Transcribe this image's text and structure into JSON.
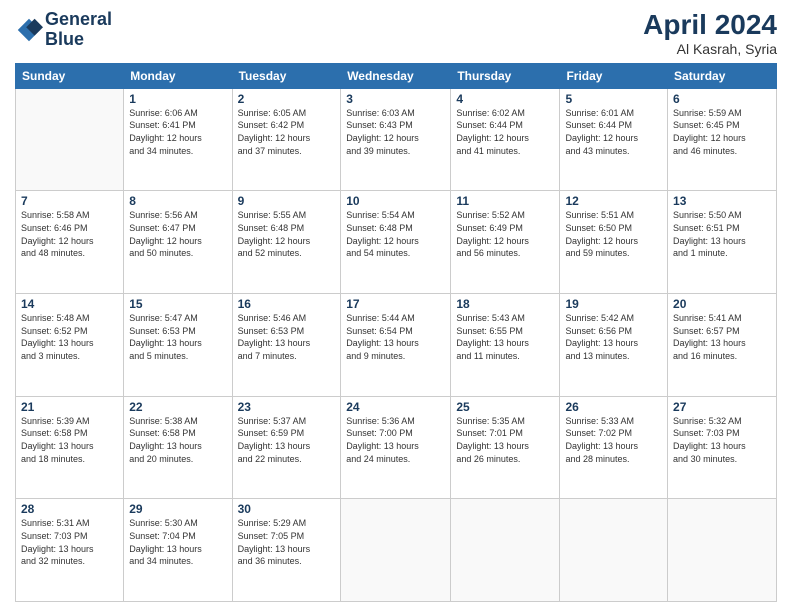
{
  "header": {
    "logo_line1": "General",
    "logo_line2": "Blue",
    "title": "April 2024",
    "location": "Al Kasrah, Syria"
  },
  "weekdays": [
    "Sunday",
    "Monday",
    "Tuesday",
    "Wednesday",
    "Thursday",
    "Friday",
    "Saturday"
  ],
  "weeks": [
    [
      {
        "day": "",
        "info": ""
      },
      {
        "day": "1",
        "info": "Sunrise: 6:06 AM\nSunset: 6:41 PM\nDaylight: 12 hours\nand 34 minutes."
      },
      {
        "day": "2",
        "info": "Sunrise: 6:05 AM\nSunset: 6:42 PM\nDaylight: 12 hours\nand 37 minutes."
      },
      {
        "day": "3",
        "info": "Sunrise: 6:03 AM\nSunset: 6:43 PM\nDaylight: 12 hours\nand 39 minutes."
      },
      {
        "day": "4",
        "info": "Sunrise: 6:02 AM\nSunset: 6:44 PM\nDaylight: 12 hours\nand 41 minutes."
      },
      {
        "day": "5",
        "info": "Sunrise: 6:01 AM\nSunset: 6:44 PM\nDaylight: 12 hours\nand 43 minutes."
      },
      {
        "day": "6",
        "info": "Sunrise: 5:59 AM\nSunset: 6:45 PM\nDaylight: 12 hours\nand 46 minutes."
      }
    ],
    [
      {
        "day": "7",
        "info": "Sunrise: 5:58 AM\nSunset: 6:46 PM\nDaylight: 12 hours\nand 48 minutes."
      },
      {
        "day": "8",
        "info": "Sunrise: 5:56 AM\nSunset: 6:47 PM\nDaylight: 12 hours\nand 50 minutes."
      },
      {
        "day": "9",
        "info": "Sunrise: 5:55 AM\nSunset: 6:48 PM\nDaylight: 12 hours\nand 52 minutes."
      },
      {
        "day": "10",
        "info": "Sunrise: 5:54 AM\nSunset: 6:48 PM\nDaylight: 12 hours\nand 54 minutes."
      },
      {
        "day": "11",
        "info": "Sunrise: 5:52 AM\nSunset: 6:49 PM\nDaylight: 12 hours\nand 56 minutes."
      },
      {
        "day": "12",
        "info": "Sunrise: 5:51 AM\nSunset: 6:50 PM\nDaylight: 12 hours\nand 59 minutes."
      },
      {
        "day": "13",
        "info": "Sunrise: 5:50 AM\nSunset: 6:51 PM\nDaylight: 13 hours\nand 1 minute."
      }
    ],
    [
      {
        "day": "14",
        "info": "Sunrise: 5:48 AM\nSunset: 6:52 PM\nDaylight: 13 hours\nand 3 minutes."
      },
      {
        "day": "15",
        "info": "Sunrise: 5:47 AM\nSunset: 6:53 PM\nDaylight: 13 hours\nand 5 minutes."
      },
      {
        "day": "16",
        "info": "Sunrise: 5:46 AM\nSunset: 6:53 PM\nDaylight: 13 hours\nand 7 minutes."
      },
      {
        "day": "17",
        "info": "Sunrise: 5:44 AM\nSunset: 6:54 PM\nDaylight: 13 hours\nand 9 minutes."
      },
      {
        "day": "18",
        "info": "Sunrise: 5:43 AM\nSunset: 6:55 PM\nDaylight: 13 hours\nand 11 minutes."
      },
      {
        "day": "19",
        "info": "Sunrise: 5:42 AM\nSunset: 6:56 PM\nDaylight: 13 hours\nand 13 minutes."
      },
      {
        "day": "20",
        "info": "Sunrise: 5:41 AM\nSunset: 6:57 PM\nDaylight: 13 hours\nand 16 minutes."
      }
    ],
    [
      {
        "day": "21",
        "info": "Sunrise: 5:39 AM\nSunset: 6:58 PM\nDaylight: 13 hours\nand 18 minutes."
      },
      {
        "day": "22",
        "info": "Sunrise: 5:38 AM\nSunset: 6:58 PM\nDaylight: 13 hours\nand 20 minutes."
      },
      {
        "day": "23",
        "info": "Sunrise: 5:37 AM\nSunset: 6:59 PM\nDaylight: 13 hours\nand 22 minutes."
      },
      {
        "day": "24",
        "info": "Sunrise: 5:36 AM\nSunset: 7:00 PM\nDaylight: 13 hours\nand 24 minutes."
      },
      {
        "day": "25",
        "info": "Sunrise: 5:35 AM\nSunset: 7:01 PM\nDaylight: 13 hours\nand 26 minutes."
      },
      {
        "day": "26",
        "info": "Sunrise: 5:33 AM\nSunset: 7:02 PM\nDaylight: 13 hours\nand 28 minutes."
      },
      {
        "day": "27",
        "info": "Sunrise: 5:32 AM\nSunset: 7:03 PM\nDaylight: 13 hours\nand 30 minutes."
      }
    ],
    [
      {
        "day": "28",
        "info": "Sunrise: 5:31 AM\nSunset: 7:03 PM\nDaylight: 13 hours\nand 32 minutes."
      },
      {
        "day": "29",
        "info": "Sunrise: 5:30 AM\nSunset: 7:04 PM\nDaylight: 13 hours\nand 34 minutes."
      },
      {
        "day": "30",
        "info": "Sunrise: 5:29 AM\nSunset: 7:05 PM\nDaylight: 13 hours\nand 36 minutes."
      },
      {
        "day": "",
        "info": ""
      },
      {
        "day": "",
        "info": ""
      },
      {
        "day": "",
        "info": ""
      },
      {
        "day": "",
        "info": ""
      }
    ]
  ]
}
